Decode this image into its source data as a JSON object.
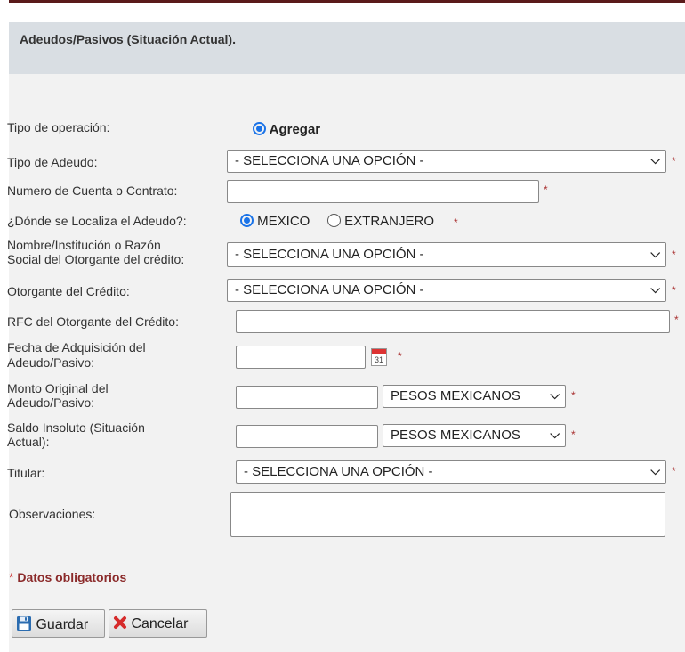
{
  "panel": {
    "title": "Adeudos/Pasivos (Situación Actual)."
  },
  "form": {
    "tipo_operacion": {
      "label": "Tipo de operación:",
      "option": "Agregar"
    },
    "tipo_adeudo": {
      "label": "Tipo de Adeudo:",
      "value": "- SELECCIONA UNA OPCIÓN -"
    },
    "numero_cuenta": {
      "label": "Numero de Cuenta o Contrato:",
      "value": ""
    },
    "localiza": {
      "label": "¿Dónde se Localiza el Adeudo?:",
      "option_1": "MEXICO",
      "option_2": "EXTRANJERO"
    },
    "nombre_institucion": {
      "label_1": "Nombre/Institución o Razón",
      "label_2": "Social del Otorgante del crédito:",
      "value": "- SELECCIONA UNA OPCIÓN -"
    },
    "otorgante": {
      "label": "Otorgante del Crédito:",
      "value": "- SELECCIONA UNA OPCIÓN -"
    },
    "rfc": {
      "label": "RFC del Otorgante del Crédito:",
      "value": ""
    },
    "fecha": {
      "label_1": "Fecha de Adquisición del",
      "label_2": "Adeudo/Pasivo:",
      "value": "",
      "calendar_day": "31"
    },
    "monto": {
      "label_1": "Monto Original del",
      "label_2": "Adeudo/Pasivo:",
      "value": "",
      "currency": "PESOS MEXICANOS"
    },
    "saldo": {
      "label_1": "Saldo Insoluto (Situación",
      "label_2": "Actual):",
      "value": "",
      "currency": "PESOS MEXICANOS"
    },
    "titular": {
      "label": "Titular:",
      "value": "- SELECCIONA UNA OPCIÓN -"
    },
    "observaciones": {
      "label": "Observaciones:",
      "value": ""
    },
    "required_mark": "*",
    "required_note": "Datos obligatorios"
  },
  "buttons": {
    "save": "Guardar",
    "cancel": "Cancelar"
  },
  "icons": {
    "save": "floppy-disk-icon",
    "cancel": "x-mark-icon",
    "calendar": "calendar-icon",
    "chevron": "chevron-down-icon"
  },
  "colors": {
    "required": "#aa3333",
    "radio": "#1a73e8",
    "header": "#d9dee3"
  }
}
